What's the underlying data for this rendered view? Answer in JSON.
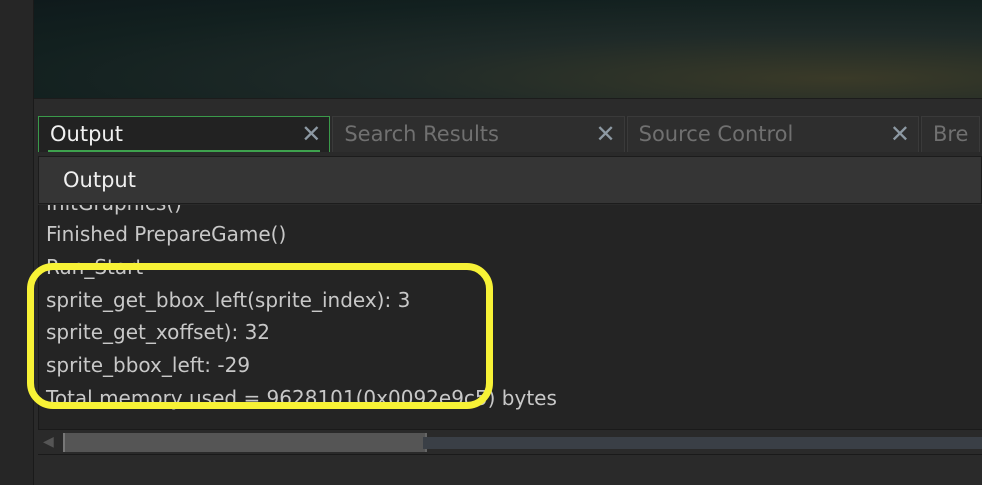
{
  "tabs": [
    {
      "label": "Output",
      "active": true
    },
    {
      "label": "Search Results",
      "active": false
    },
    {
      "label": "Source Control",
      "active": false
    },
    {
      "label": "Bre",
      "active": false
    }
  ],
  "panel_header": "Output",
  "log_lines": [
    "InitGraphics()",
    "Finished PrepareGame()",
    "Run_Start",
    "sprite_get_bbox_left(sprite_index): 3",
    "sprite_get_xoffset): 32",
    "sprite_bbox_left: -29",
    "Total memory used = 9628101(0x0092e9c5) bytes"
  ],
  "colors": {
    "highlight": "#f7f236",
    "active_tab_accent": "#3ea24e"
  }
}
